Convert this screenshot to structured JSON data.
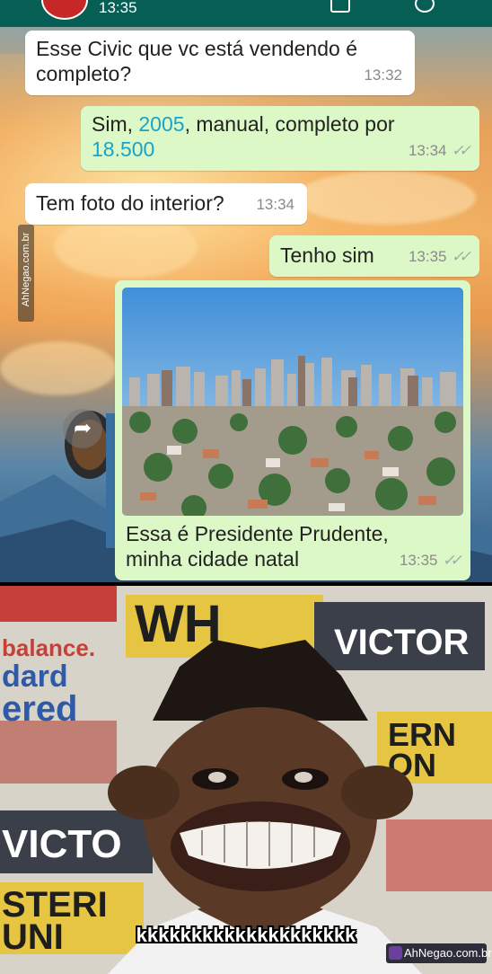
{
  "status_bar": {
    "time": "13:35"
  },
  "messages": [
    {
      "direction": "in",
      "text": "Esse Civic que vc está vendendo é completo?",
      "time": "13:32"
    },
    {
      "direction": "out",
      "text_parts": [
        "Sim, ",
        "2005",
        ", manual, completo por ",
        "18.500"
      ],
      "time": "13:34"
    },
    {
      "direction": "in",
      "text": "Tem foto do interior?",
      "time": "13:34"
    },
    {
      "direction": "out",
      "text": "Tenho sim",
      "time": "13:35"
    },
    {
      "direction": "out",
      "type": "image",
      "caption_line1": "Essa é Presidente Prudente,",
      "caption_line2": "minha cidade natal",
      "time": "13:35"
    }
  ],
  "watermark_side": "AhNegao.com.br",
  "meme": {
    "caption": "kkkkkkkkkkkkkkkkkkkk",
    "watermark": "AhNegao.com.br",
    "background_words": [
      "WH",
      "VICTOR",
      "balance.",
      "dard",
      "ered",
      "ERN",
      "ON",
      "VICTO",
      "STERI",
      "UNI"
    ]
  },
  "colors": {
    "incoming": "#ffffff",
    "outgoing": "#dcf8c6",
    "link_number": "#1aa3c9",
    "header": "#075e54"
  }
}
